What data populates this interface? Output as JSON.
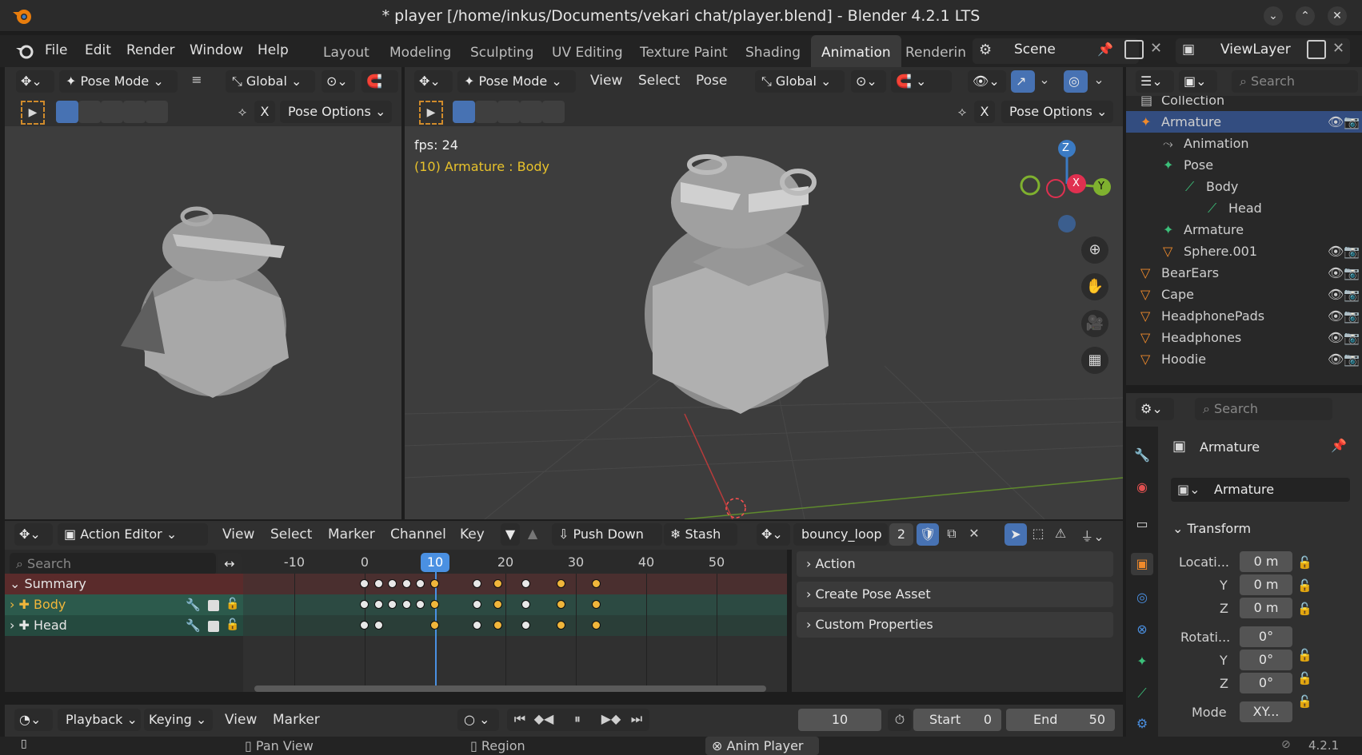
{
  "window": {
    "title": "* player [/home/inkus/Documents/vekari chat/player.blend] - Blender 4.2.1 LTS"
  },
  "menu": {
    "items": [
      "File",
      "Edit",
      "Render",
      "Window",
      "Help"
    ]
  },
  "workspaces": [
    "Layout",
    "Modeling",
    "Sculpting",
    "UV Editing",
    "Texture Paint",
    "Shading",
    "Animation",
    "Renderin"
  ],
  "scene": {
    "label": "Scene",
    "view_layer": "ViewLayer"
  },
  "left_viewport": {
    "mode": "Pose Mode",
    "orientation": "Global",
    "options": "Pose Options",
    "x_label": "X"
  },
  "main_viewport": {
    "mode": "Pose Mode",
    "menus": [
      "View",
      "Select",
      "Pose"
    ],
    "orientation": "Global",
    "options": "Pose Options",
    "x_label": "X",
    "fps": "fps: 24",
    "active": "(10) Armature : Body",
    "axes": {
      "z": "Z",
      "x": "X",
      "y": "Y"
    }
  },
  "outliner": {
    "search_placeholder": "Search",
    "rows": [
      {
        "label": "Collection",
        "indent": 0
      },
      {
        "label": "Armature",
        "indent": 0,
        "selected": true
      },
      {
        "label": "Animation",
        "indent": 1
      },
      {
        "label": "Pose",
        "indent": 1
      },
      {
        "label": "Body",
        "indent": 2
      },
      {
        "label": "Head",
        "indent": 3
      },
      {
        "label": "Armature",
        "indent": 1
      },
      {
        "label": "Sphere.001",
        "indent": 1
      },
      {
        "label": "BearEars",
        "indent": 0
      },
      {
        "label": "Cape",
        "indent": 0
      },
      {
        "label": "HeadphonePads",
        "indent": 0
      },
      {
        "label": "Headphones",
        "indent": 0
      },
      {
        "label": "Hoodie",
        "indent": 0
      }
    ]
  },
  "properties": {
    "search_placeholder": "Search",
    "object_name": "Armature",
    "data_name": "Armature",
    "transform_label": "Transform",
    "location_label": "Locati...",
    "y_label": "Y",
    "z_label": "Z",
    "location": [
      "0 m",
      "0 m",
      "0 m"
    ],
    "rotation_label": "Rotati...",
    "rotation": [
      "0°",
      "0°",
      "0°"
    ],
    "mode_label": "Mode",
    "mode_value": "XY..."
  },
  "action_editor": {
    "editor": "Action Editor",
    "menus": [
      "View",
      "Select",
      "Marker",
      "Channel",
      "Key"
    ],
    "push_down": "Push Down",
    "stash": "Stash",
    "action": "bouncy_loop",
    "users": "2",
    "search_placeholder": "Search",
    "frame_labels": [
      "-10",
      "0",
      "10",
      "20",
      "30",
      "40",
      "50"
    ],
    "current_frame": "10",
    "channels": [
      "Summary",
      "Body",
      "Head"
    ],
    "panels": [
      "Action",
      "Create Pose Asset",
      "Custom Properties"
    ]
  },
  "timeline": {
    "playback": "Playback",
    "keying": "Keying",
    "view": "View",
    "marker": "Marker",
    "frame": "10",
    "start_label": "Start",
    "start": "0",
    "end_label": "End",
    "end": "50"
  },
  "status": {
    "pan": "Pan View",
    "region": "Region",
    "anim": "Anim Player",
    "version": "4.2.1"
  }
}
